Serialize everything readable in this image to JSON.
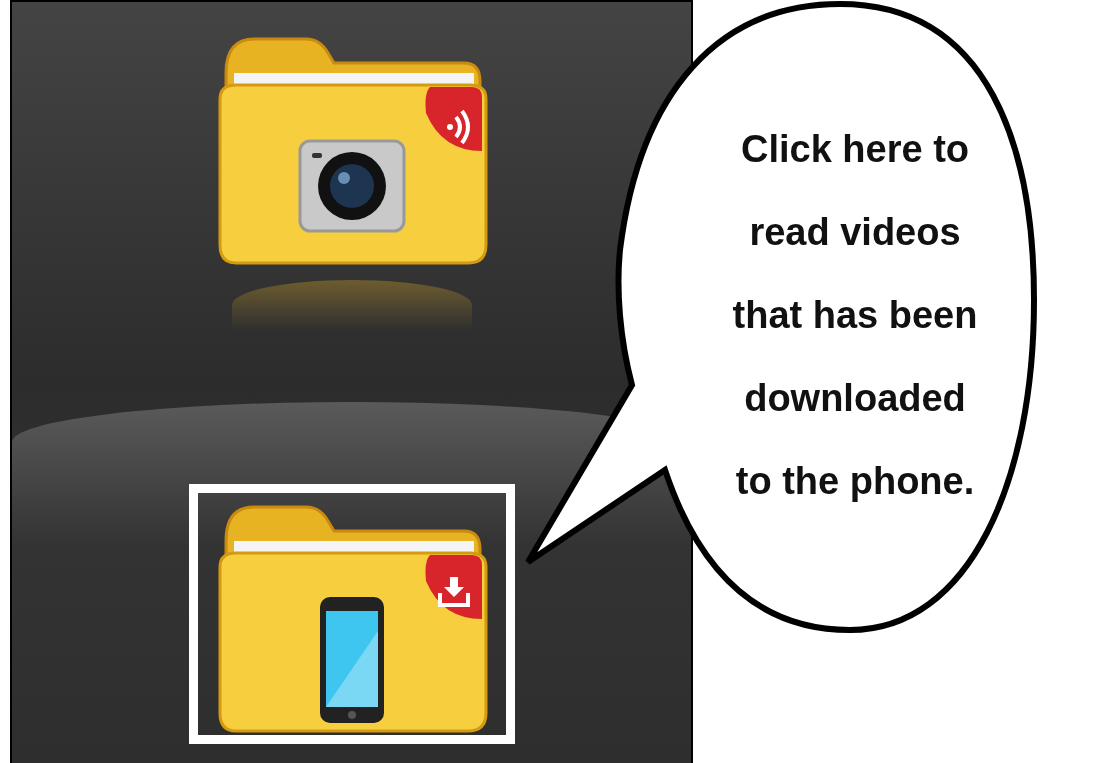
{
  "screen": {
    "folders": [
      {
        "kind": "camera",
        "selected": false
      },
      {
        "kind": "phone",
        "selected": true
      }
    ]
  },
  "callout": {
    "lines": [
      "Click here to",
      "read videos",
      "that has been",
      "downloaded",
      "to the phone."
    ]
  }
}
